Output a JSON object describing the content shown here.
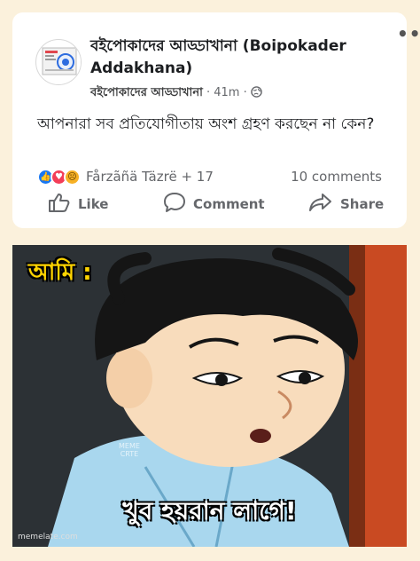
{
  "post": {
    "page_name": "বইপোকাদের আড্ডাখানা (Boipokader Addakhana)",
    "sub_name": "বইপোকাদের আড্ডাখানা",
    "time": "41m",
    "text": "আপনারা সব প্রতিযোগীতায় অংশ গ্রহণ করছেন না কেন?",
    "reactions": [
      "like",
      "love",
      "sad"
    ],
    "reactors": "Fårzãñä Täzrë + 17",
    "comments": "10 comments"
  },
  "actions": {
    "like": "Like",
    "comment": "Comment",
    "share": "Share"
  },
  "meme": {
    "label": "আমি :",
    "caption": "খুব হয়রান লাগে!",
    "source": "memelate.com",
    "watermark": "MEME\nCRTE"
  },
  "colors": {
    "page_bg": "#fbf1dc",
    "card_bg": "#ffffff",
    "text": "#1c1e21",
    "muted": "#65676b",
    "like_blue": "#1877f2",
    "meme_label": "#ffd400"
  }
}
